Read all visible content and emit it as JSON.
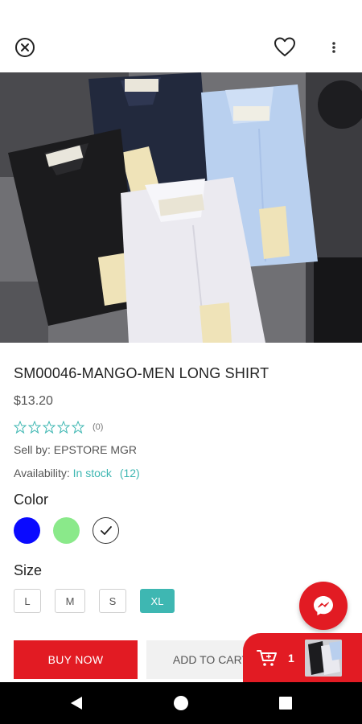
{
  "product": {
    "title": "SM00046-MANGO-MEN LONG SHIRT",
    "price": "$13.20",
    "rating_count": "(0)",
    "seller": "Sell by: EPSTORE MGR",
    "availability_label": "Availability:",
    "availability_value": "In stock",
    "availability_count": "(12)"
  },
  "color_section": {
    "label": "Color",
    "options": [
      {
        "name": "blue",
        "color": "#0a0aff"
      },
      {
        "name": "green",
        "color": "#8ae98a"
      },
      {
        "name": "white",
        "color": "#ffffff",
        "selected": true
      }
    ]
  },
  "size_section": {
    "label": "Size",
    "options": [
      "L",
      "M",
      "S",
      "XL"
    ],
    "selected": "XL"
  },
  "actions": {
    "buy_now": "BUY NOW",
    "add_to_cart": "ADD TO CART",
    "cart_count": "1"
  },
  "icons": {
    "close": "close-icon",
    "favorite": "heart-icon",
    "more": "more-vertical-icon",
    "messenger": "messenger-icon",
    "cart": "cart-icon"
  },
  "theme": {
    "accent_red": "#e21b23",
    "accent_teal": "#3eb7b2"
  }
}
